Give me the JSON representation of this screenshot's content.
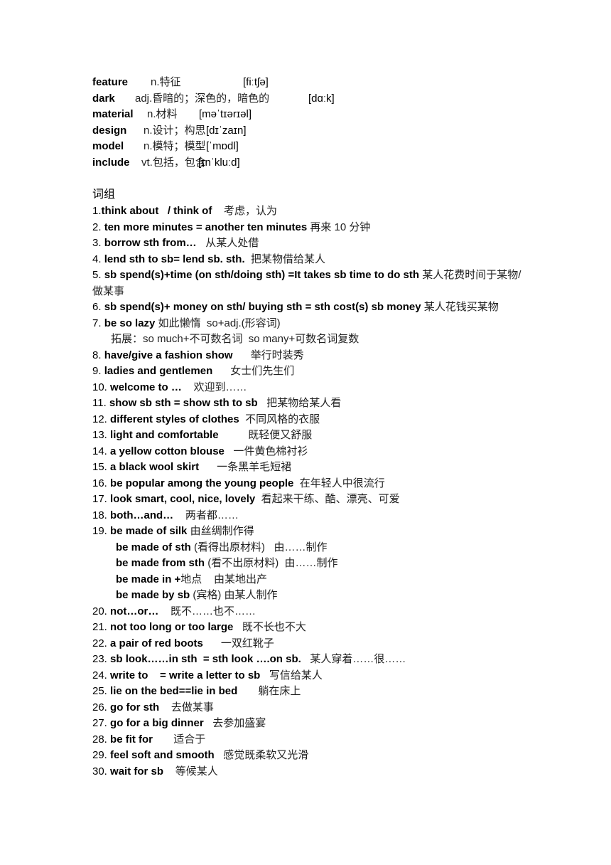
{
  "vocabulary": [
    {
      "word": "feature",
      "meaning": "n.特征",
      "phonetic": "[fiːtʃə]"
    },
    {
      "word": "dark",
      "meaning": "adj.昏暗的；深色的，暗色的",
      "phonetic": "[dɑːk]"
    },
    {
      "word": "material",
      "meaning": "n.材料",
      "phonetic": "[məˈtɪərɪəl]"
    },
    {
      "word": "design",
      "meaning": "n.设计；构思",
      "phonetic": "[dɪˈzaɪn]"
    },
    {
      "word": "model",
      "meaning": "n.模特；模型",
      "phonetic": "[ˈmɒdl]"
    },
    {
      "word": "include",
      "meaning": "vt.包括，包含",
      "phonetic": "[ɪnˈkluːd]"
    }
  ],
  "phrases_heading": "词组",
  "phrases": [
    {
      "num": "1.",
      "en": "think about   / think of",
      "cn": "    考虑，认为"
    },
    {
      "num": "2. ",
      "en": "ten more minutes = another ten minutes",
      "cn": " 再来 10 分钟"
    },
    {
      "num": "3. ",
      "en": "borrow sth from…",
      "cn": "   从某人处借"
    },
    {
      "num": "4. ",
      "en": "lend sth to sb= lend sb. sth.",
      "cn": "  把某物借给某人"
    },
    {
      "num": "5. ",
      "en": "sb spend(s)+time (on sth/doing sth) =It takes sb time to do sth",
      "cn": " 某人花费时间于某物/做某事",
      "wrap": true
    },
    {
      "num": "6. ",
      "en": "sb spend(s)+ money on sth/ buying sth = sth cost(s) sb money",
      "cn": " 某人花钱买某物"
    },
    {
      "num": "7. ",
      "en": "be so lazy",
      "cn": " 如此懒惰  so+adj.(形容词)"
    },
    {
      "num": "",
      "en": "",
      "cn": "拓展：so much+不可数名词  so many+可数名词复数",
      "indent": 1
    },
    {
      "num": "8. ",
      "en": "have/give a fashion show",
      "cn": "      举行时装秀"
    },
    {
      "num": "9. ",
      "en": "ladies and gentlemen",
      "cn": "      女士们先生们"
    },
    {
      "num": "10. ",
      "en": "welcome to …",
      "cn": "    欢迎到……"
    },
    {
      "num": "11. ",
      "en": "show sb sth = show sth to sb",
      "cn": "   把某物给某人看"
    },
    {
      "num": "12. ",
      "en": "different styles of clothes",
      "cn": "  不同风格的衣服"
    },
    {
      "num": "13. ",
      "en": "light and comfortable",
      "cn": "          既轻便又舒服"
    },
    {
      "num": "14. ",
      "en": "a yellow cotton blouse",
      "cn": "   一件黄色棉衬衫"
    },
    {
      "num": "15. ",
      "en": "a black wool skirt",
      "cn": "      一条黑羊毛短裙"
    },
    {
      "num": "16. ",
      "en": "be popular among the young people",
      "cn": "  在年轻人中很流行"
    },
    {
      "num": "17. ",
      "en": "look smart, cool, nice, lovely",
      "cn": "  看起来干练、酷、漂亮、可爱"
    },
    {
      "num": "18. ",
      "en": "both…and…",
      "cn": "    两者都……"
    },
    {
      "num": "19. ",
      "en": "be made of silk",
      "cn": " 由丝绸制作得"
    },
    {
      "num": "",
      "en": "be made of sth",
      "cn": " (看得出原材料)   由……制作",
      "indent": 2
    },
    {
      "num": "",
      "en": "be made from sth",
      "cn": " (看不出原材料)  由……制作",
      "indent": 2
    },
    {
      "num": "",
      "en": "be made in +",
      "cn": "地点    由某地出产",
      "indent": 2
    },
    {
      "num": "",
      "en": "be made by sb",
      "cn": " (宾格) 由某人制作",
      "indent": 2
    },
    {
      "num": "20. ",
      "en": "not…or…",
      "cn": "    既不……也不……"
    },
    {
      "num": "21. ",
      "en": "not too long or too large",
      "cn": "   既不长也不大"
    },
    {
      "num": "22. ",
      "en": "a pair of red boots",
      "cn": "      一双红靴子"
    },
    {
      "num": "23. ",
      "en": "sb look……in sth  = sth look ….on sb.",
      "cn": "   某人穿着……很……"
    },
    {
      "num": "24. ",
      "en": "write to    = write a letter to sb",
      "cn": "   写信给某人"
    },
    {
      "num": "25. ",
      "en": "lie on the bed==lie in bed",
      "cn": "       躺在床上"
    },
    {
      "num": "26. ",
      "en": "go for sth",
      "cn": "    去做某事"
    },
    {
      "num": "27. ",
      "en": "go for a big dinner",
      "cn": "   去参加盛宴"
    },
    {
      "num": "28. ",
      "en": "be fit for",
      "cn": "       适合于"
    },
    {
      "num": "29. ",
      "en": "feel soft and smooth",
      "cn": "   感觉既柔软又光滑"
    },
    {
      "num": "30. ",
      "en": "wait for sb",
      "cn": "    等候某人"
    }
  ]
}
